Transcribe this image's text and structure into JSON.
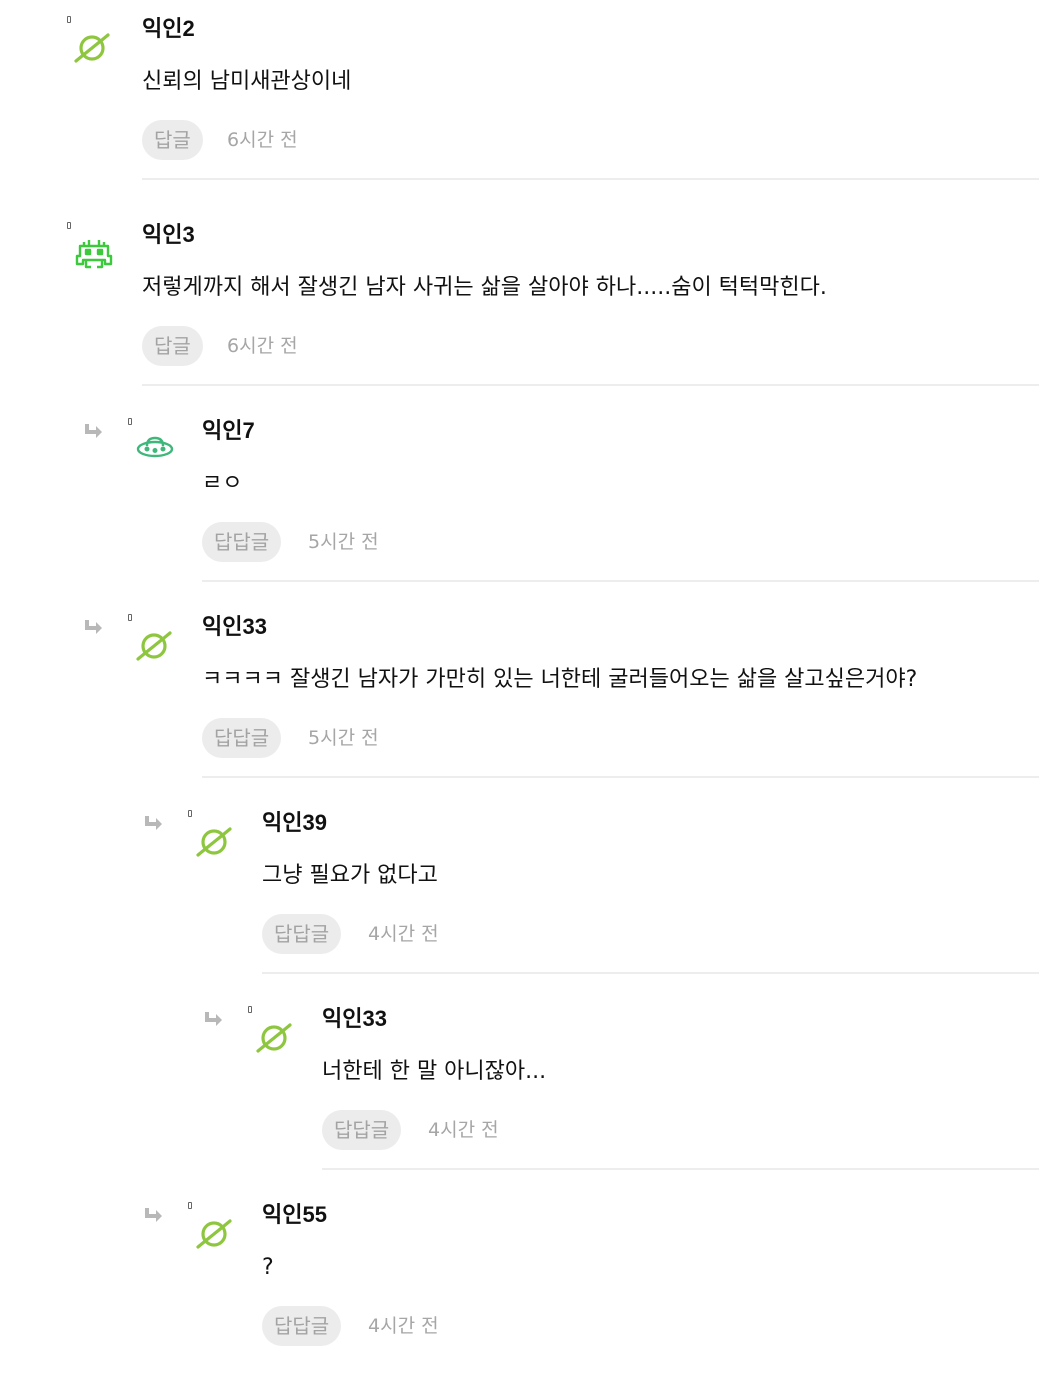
{
  "comments": [
    {
      "author": "익인2",
      "text": "신뢰의 남미새관상이네",
      "reply_label": "답글",
      "time": "6시간 전",
      "avatar_icon": "planet-icon",
      "avatar_color": "#8ec63f"
    },
    {
      "author": "익인3",
      "text": "저렇게까지 해서 잘생긴 남자 사귀는 삶을 살아야 하나.....숨이 턱턱막힌다.",
      "reply_label": "답글",
      "time": "6시간 전",
      "avatar_icon": "space-invader-icon",
      "avatar_color": "#3cc93c"
    },
    {
      "author": "익인7",
      "text": "ㄹㅇ",
      "reply_label": "답답글",
      "time": "5시간 전",
      "avatar_icon": "ufo-icon",
      "avatar_color": "#3fb77a"
    },
    {
      "author": "익인33",
      "text": "ㅋㅋㅋㅋ 잘생긴 남자가 가만히 있는 너한테 굴러들어오는 삶을 살고싶은거야?",
      "reply_label": "답답글",
      "time": "5시간 전",
      "avatar_icon": "planet-icon",
      "avatar_color": "#8ec63f"
    },
    {
      "author": "익인39",
      "text": "그냥 필요가 없다고",
      "reply_label": "답답글",
      "time": "4시간 전",
      "avatar_icon": "planet-icon",
      "avatar_color": "#8ec63f"
    },
    {
      "author": "익인33",
      "text": "너한테 한 말 아니잖아...",
      "reply_label": "답답글",
      "time": "4시간 전",
      "avatar_icon": "planet-icon",
      "avatar_color": "#8ec63f"
    },
    {
      "author": "익인55",
      "text": "?",
      "reply_label": "답답글",
      "time": "4시간 전",
      "avatar_icon": "planet-icon",
      "avatar_color": "#8ec63f"
    }
  ],
  "reply_arrow_icon": "reply-arrow-icon"
}
